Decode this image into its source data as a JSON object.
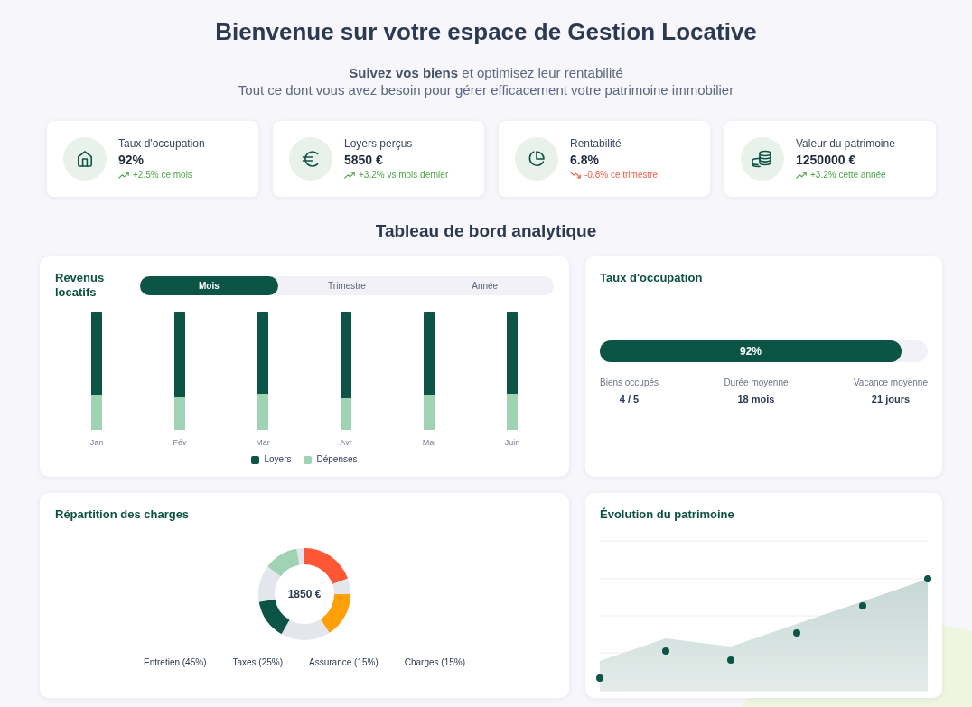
{
  "header": {
    "title": "Bienvenue sur votre espace de Gestion Locative",
    "subtitle": "**Suivez vos biens** et optimisez leur rentabilité",
    "tagline": "Tout ce dont vous avez besoin pour gérer efficacement votre patrimoine immobilier"
  },
  "stats": [
    {
      "label": "Taux d'occupation",
      "value": "92%",
      "negative": false,
      "change": "+2.5% ce mois"
    },
    {
      "label": "Loyers perçus",
      "value": "5850 €",
      "negative": false,
      "change": "+3.2% vs mois dernier"
    },
    {
      "label": "Rentabilité",
      "value": "6.8%",
      "negative": true,
      "change": "-0.8% ce trimestre"
    },
    {
      "label": "Valeur du patrimoine",
      "value": "1250000 €",
      "negative": false,
      "change": "+3.2% cette année"
    }
  ],
  "dashboard": {
    "title": "Tableau de bord analytique",
    "revenue": {
      "title": "Revenus locatifs",
      "tabs": [
        {
          "label": "Mois",
          "selected": true
        },
        {
          "label": "Trimestre",
          "selected": false
        },
        {
          "label": "Année",
          "selected": false
        }
      ],
      "months": [
        "Jan",
        "Fév",
        "Mar",
        "Avr",
        "Mai",
        "Juin"
      ],
      "legend": [
        {
          "label": "Loyers",
          "color": "#0c5446"
        },
        {
          "label": "Dépenses",
          "color": "#9fd3b3"
        }
      ]
    },
    "occupancy": {
      "title": "Taux d'occupation",
      "level": 0.92,
      "reading": "92%",
      "metrics": [
        {
          "label": "Biens occupés",
          "value": "4 / 5"
        },
        {
          "label": "Durée moyenne",
          "value": "18 mois"
        },
        {
          "label": "Vacance moyenne",
          "value": "21 jours"
        }
      ]
    },
    "charges": {
      "title": "Répartition des charges",
      "total": "1850 €",
      "legend": [
        "Entretien (45%)",
        "Taxes (25%)",
        "Assurance (15%)",
        "Charges (15%)"
      ]
    },
    "evolution": {
      "title": "Évolution du patrimoine"
    }
  }
}
